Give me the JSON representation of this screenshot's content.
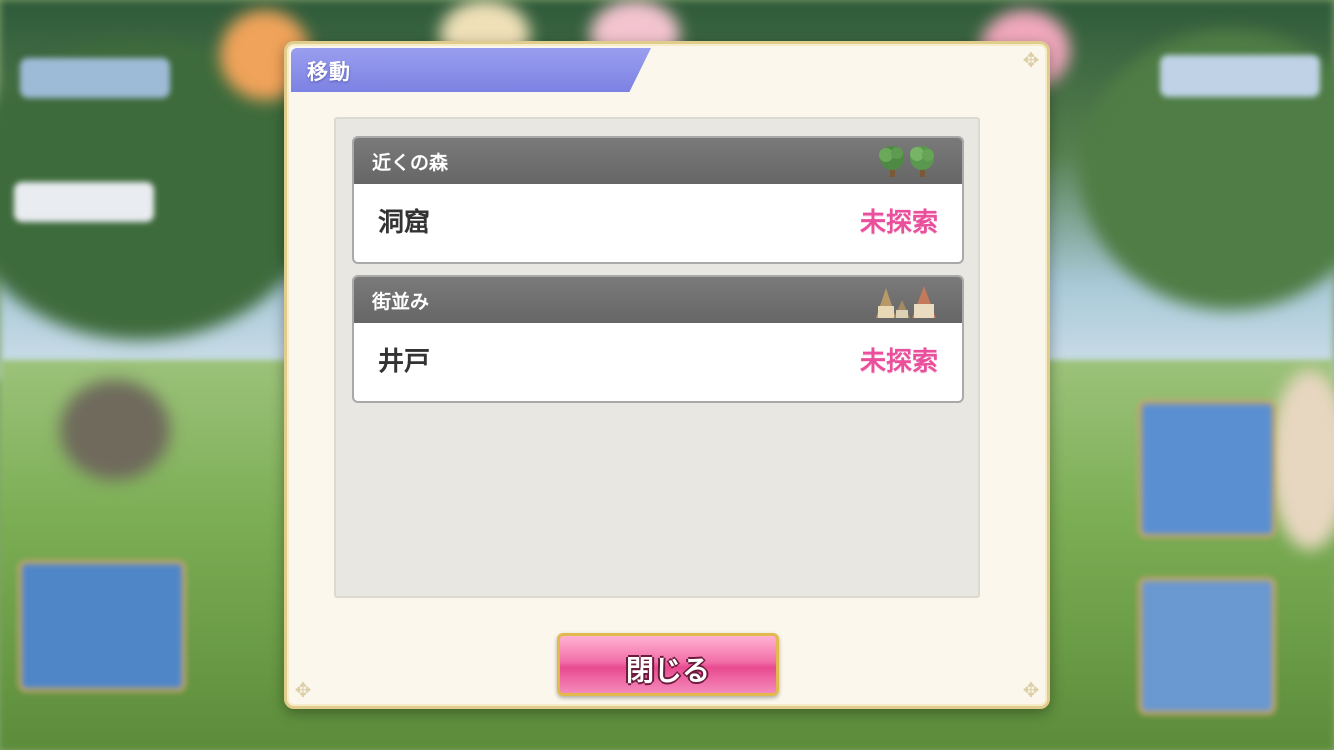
{
  "dialog": {
    "title": "移動",
    "locations": [
      {
        "area": "近くの森",
        "area_icon": "trees-icon",
        "spot": "洞窟",
        "status": "未探索"
      },
      {
        "area": "街並み",
        "area_icon": "houses-icon",
        "spot": "井戸",
        "status": "未探索"
      }
    ],
    "close_label": "閉じる"
  },
  "colors": {
    "title_tab": "#8a8fe9",
    "status_unexplored": "#e94f9a",
    "close_button": "#f26fa9",
    "card_header": "#707070"
  }
}
